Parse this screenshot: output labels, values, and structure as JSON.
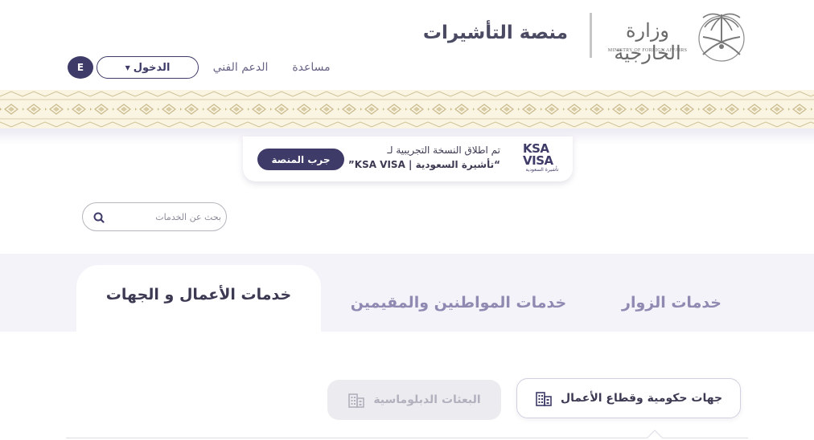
{
  "header": {
    "emblem": "palm-swords-emblem",
    "ministry_ar": "وزارة الخارجية",
    "ministry_en": "MINISTRY OF FOREIGN AFFAIRS",
    "platform_title": "منصة التأشيرات",
    "nav": {
      "help": "مساعدة",
      "support": "الدعم الفني",
      "login": "الدخول",
      "language": "E"
    }
  },
  "announcement": {
    "logo_line1": "KSA",
    "logo_line2": "VISA",
    "logo_line3": "تأشيرة السعودية",
    "line1": "تم اطلاق النسخة التجريبية لـ",
    "line2": "“تأشيرة السعودية | KSA VISA”",
    "button": "جرب المنصة"
  },
  "search": {
    "placeholder": "بحث عن الخدمات",
    "icon": "search-icon"
  },
  "tabs": [
    {
      "label": "خدمات الزوار",
      "active": false
    },
    {
      "label": "خدمات المواطنين والمقيمين",
      "active": false
    },
    {
      "label": "خدمات الأعمال و الجهات",
      "active": true
    }
  ],
  "subtabs": [
    {
      "label": "جهات حكومية وقطاع الأعمال",
      "icon": "building-icon",
      "active": true
    },
    {
      "label": "البعثات الدبلوماسية",
      "icon": "building-icon",
      "active": false
    }
  ],
  "colors": {
    "primary": "#3e3b68",
    "tab_inactive": "#8f8ab2",
    "band": "#f4f3f9",
    "pattern": "#c8b98a"
  }
}
